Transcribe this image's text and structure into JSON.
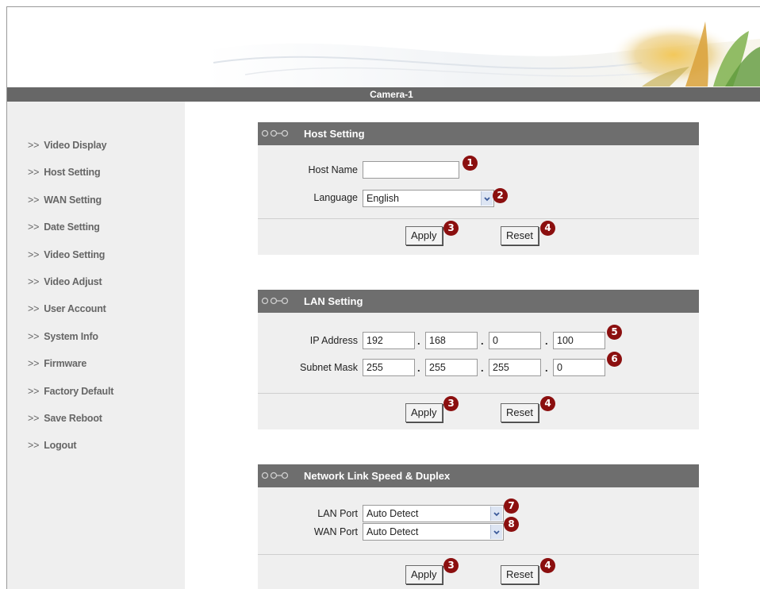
{
  "title": "Camera-1",
  "sidebar": {
    "arrow": ">>",
    "items": [
      "Video Display",
      "Host Setting",
      "WAN Setting",
      "Date Setting",
      "Video Setting",
      "Video Adjust",
      "User Account",
      "System Info",
      "Firmware",
      "Factory Default",
      "Save Reboot",
      "Logout"
    ]
  },
  "host": {
    "title": "Host Setting",
    "host_name_label": "Host Name",
    "host_name_value": "",
    "language_label": "Language",
    "language_value": "English",
    "apply": "Apply",
    "reset": "Reset"
  },
  "lan": {
    "title": "LAN Setting",
    "ip_label": "IP Address",
    "ip": [
      "192",
      "168",
      "0",
      "100"
    ],
    "mask_label": "Subnet Mask",
    "mask": [
      "255",
      "255",
      "255",
      "0"
    ],
    "apply": "Apply",
    "reset": "Reset"
  },
  "link": {
    "title": "Network Link Speed & Duplex",
    "lan_label": "LAN Port",
    "lan_value": "Auto Detect",
    "wan_label": "WAN Port",
    "wan_value": "Auto Detect",
    "apply": "Apply",
    "reset": "Reset"
  },
  "badges": [
    "1",
    "2",
    "3",
    "4",
    "5",
    "6",
    "7",
    "8"
  ],
  "dot": ".",
  "colors": {
    "header_bar": "#6e6e6e",
    "panel_bg": "#efefef",
    "badge": "#8b0f0f"
  }
}
